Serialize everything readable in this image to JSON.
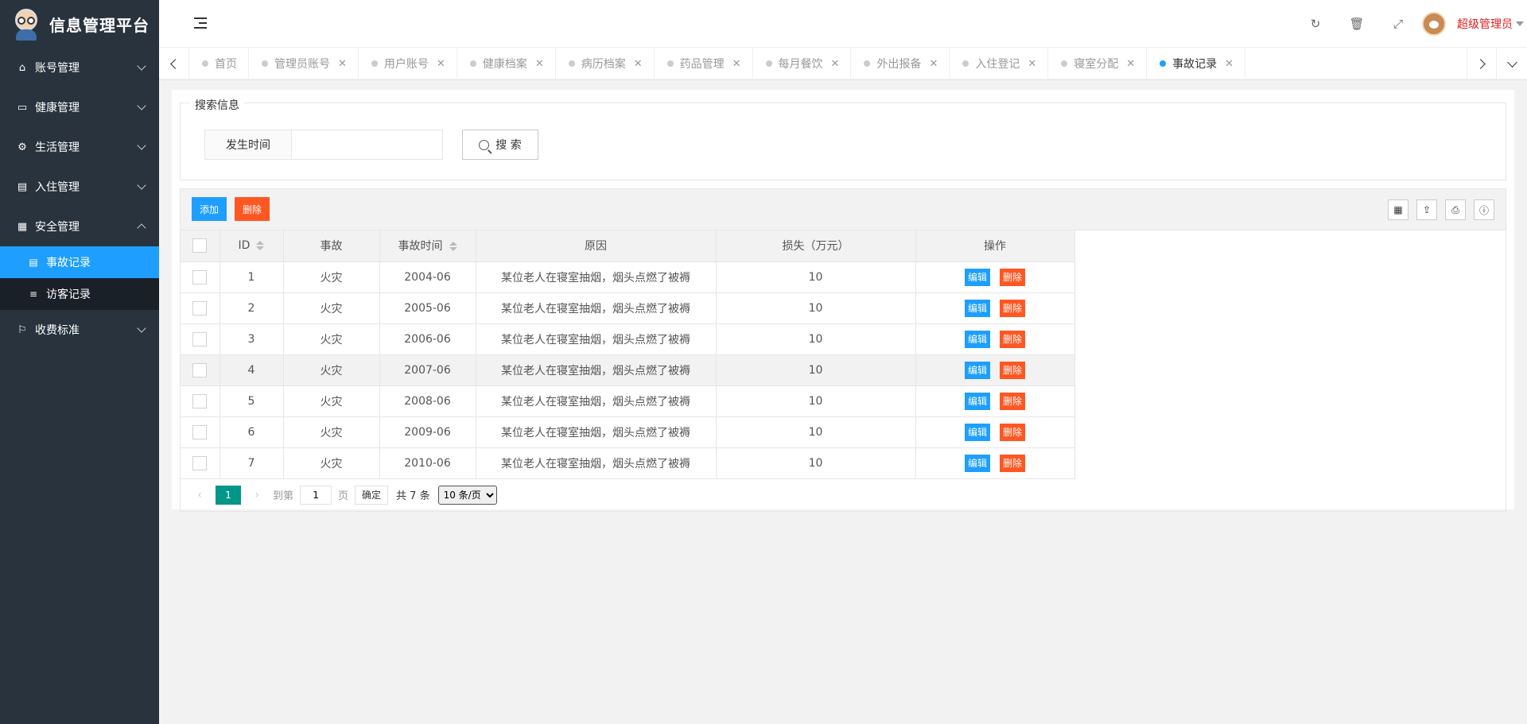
{
  "app": {
    "title": "信息管理平台"
  },
  "sidebar": {
    "items": [
      {
        "label": "账号管理",
        "icon": "home-icon"
      },
      {
        "label": "健康管理",
        "icon": "window-icon"
      },
      {
        "label": "生活管理",
        "icon": "gears-icon"
      },
      {
        "label": "入住管理",
        "icon": "file-icon"
      },
      {
        "label": "安全管理",
        "icon": "calendar-icon"
      },
      {
        "label": "收费标准",
        "icon": "flag-icon"
      }
    ],
    "sub_items": [
      {
        "label": "事故记录",
        "active": true
      },
      {
        "label": "访客记录",
        "active": false
      }
    ]
  },
  "header": {
    "user_name": "超级管理员"
  },
  "tabs": [
    {
      "label": "首页",
      "closable": false
    },
    {
      "label": "管理员账号",
      "closable": true
    },
    {
      "label": "用户账号",
      "closable": true
    },
    {
      "label": "健康档案",
      "closable": true
    },
    {
      "label": "病历档案",
      "closable": true
    },
    {
      "label": "药品管理",
      "closable": true
    },
    {
      "label": "每月餐饮",
      "closable": true
    },
    {
      "label": "外出报备",
      "closable": true
    },
    {
      "label": "入住登记",
      "closable": true
    },
    {
      "label": "寝室分配",
      "closable": true
    },
    {
      "label": "事故记录",
      "closable": true,
      "active": true
    }
  ],
  "search": {
    "legend": "搜索信息",
    "field_label": "发生时间",
    "field_value": "",
    "button_label": "搜 索"
  },
  "toolbar": {
    "add_label": "添加",
    "delete_label": "删除"
  },
  "table": {
    "columns": [
      "ID",
      "事故",
      "事故时间",
      "原因",
      "损失（万元）",
      "操作"
    ],
    "action_edit": "编辑",
    "action_delete": "删除",
    "rows": [
      {
        "id": "1",
        "event": "火灾",
        "time": "2004-06",
        "reason": "某位老人在寝室抽烟，烟头点燃了被褥",
        "loss": "10"
      },
      {
        "id": "2",
        "event": "火灾",
        "time": "2005-06",
        "reason": "某位老人在寝室抽烟，烟头点燃了被褥",
        "loss": "10"
      },
      {
        "id": "3",
        "event": "火灾",
        "time": "2006-06",
        "reason": "某位老人在寝室抽烟，烟头点燃了被褥",
        "loss": "10"
      },
      {
        "id": "4",
        "event": "火灾",
        "time": "2007-06",
        "reason": "某位老人在寝室抽烟，烟头点燃了被褥",
        "loss": "10"
      },
      {
        "id": "5",
        "event": "火灾",
        "time": "2008-06",
        "reason": "某位老人在寝室抽烟，烟头点燃了被褥",
        "loss": "10"
      },
      {
        "id": "6",
        "event": "火灾",
        "time": "2009-06",
        "reason": "某位老人在寝室抽烟，烟头点燃了被褥",
        "loss": "10"
      },
      {
        "id": "7",
        "event": "火灾",
        "time": "2010-06",
        "reason": "某位老人在寝室抽烟，烟头点燃了被褥",
        "loss": "10"
      }
    ]
  },
  "pager": {
    "current": "1",
    "goto_label": "到第",
    "goto_value": "1",
    "page_unit": "页",
    "confirm_label": "确定",
    "total_label": "共 7 条",
    "page_size": "10 条/页"
  },
  "colors": {
    "accent": "#1e9fff",
    "danger": "#ff5722",
    "pager": "#009688",
    "sidebar": "#28333e"
  }
}
